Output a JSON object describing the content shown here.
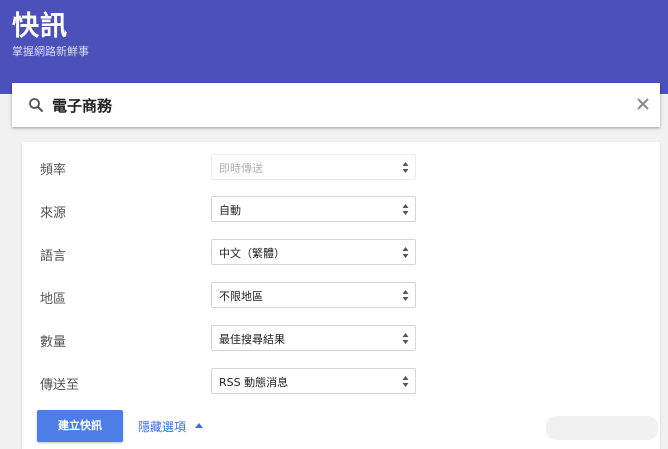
{
  "header": {
    "title": "快訊",
    "subtitle": "掌握網路新鮮事",
    "color": "#4b51b8"
  },
  "search": {
    "value": "電子商務",
    "search_icon": "search-icon",
    "clear_icon": "close-icon"
  },
  "options": [
    {
      "label": "頻率",
      "value": "即時傳送",
      "disabled": true
    },
    {
      "label": "來源",
      "value": "自動",
      "disabled": false
    },
    {
      "label": "語言",
      "value": "中文（繁體）",
      "disabled": false
    },
    {
      "label": "地區",
      "value": "不限地區",
      "disabled": false
    },
    {
      "label": "數量",
      "value": "最佳搜尋結果",
      "disabled": false
    },
    {
      "label": "傳送至",
      "value": "RSS 動態消息",
      "disabled": false
    }
  ],
  "actions": {
    "create_label": "建立快訊",
    "create_color": "#4d7de6",
    "hide_options_label": "隱藏選項",
    "hide_options_icon": "chevron-up-icon",
    "link_color": "#3b6fd6"
  }
}
